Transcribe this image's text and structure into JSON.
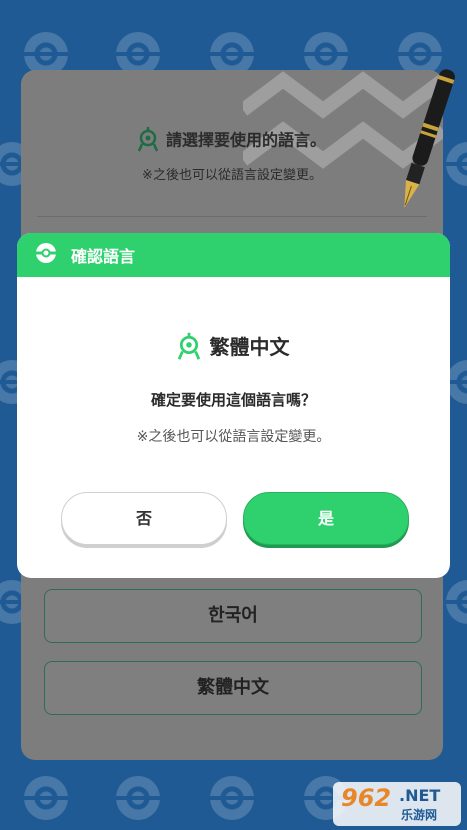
{
  "background": {
    "color": "#1f5a94",
    "pattern_icon": "pokeball-icon"
  },
  "language_panel": {
    "title": "請選擇要使用的語言。",
    "subtitle": "※之後也可以從語言設定變更。",
    "options": [
      {
        "label": "한국어"
      },
      {
        "label": "繁體中文"
      }
    ]
  },
  "modal": {
    "header_icon": "pokeball-icon",
    "title": "確認語言",
    "language_icon": "language-pin-icon",
    "selected_language": "繁體中文",
    "question": "確定要使用這個語言嗎？",
    "note": "※之後也可以從語言設定變更。",
    "buttons": {
      "no": "否",
      "yes": "是"
    },
    "accent_color": "#2fd16e"
  },
  "watermark": {
    "number": "962",
    "suffix": ".NET",
    "site": "乐游网"
  }
}
